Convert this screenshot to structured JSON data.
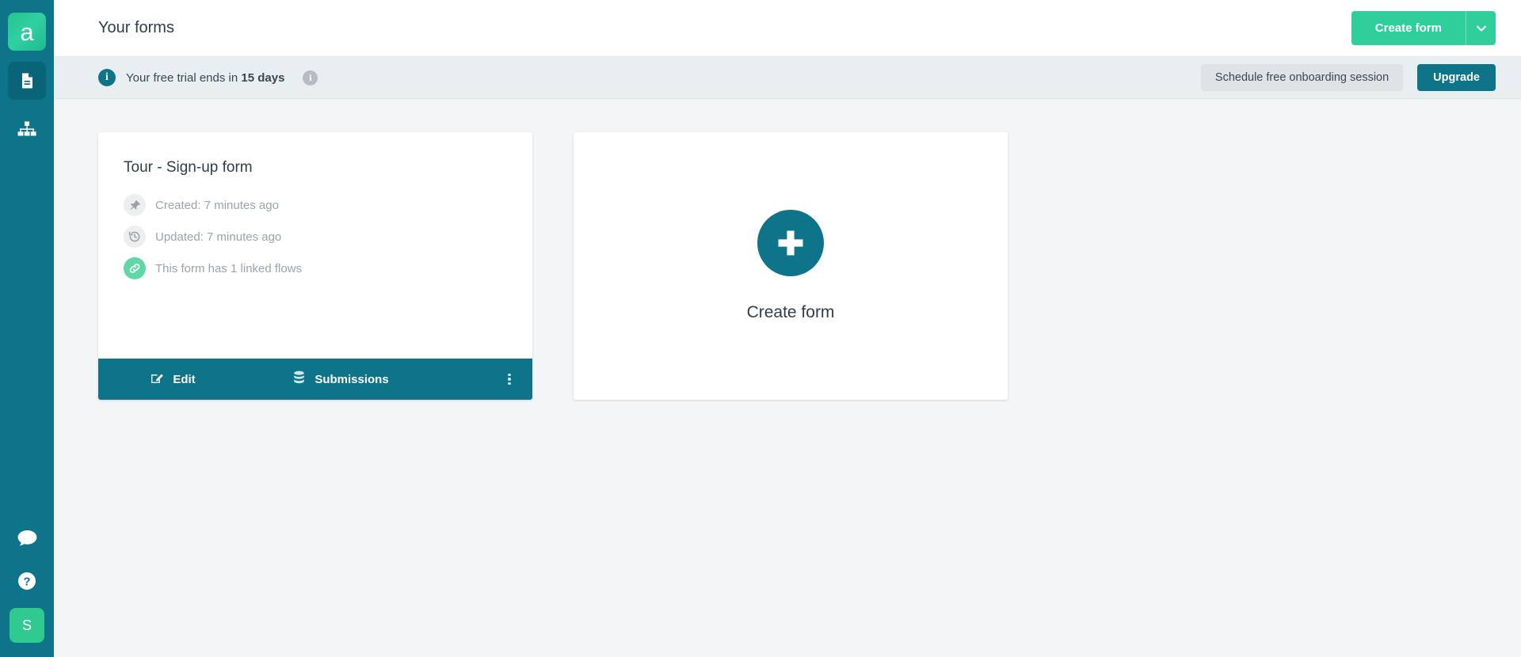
{
  "colors": {
    "sidebar_bg": "#0d7489",
    "brand_green": "#2fce9b",
    "teal": "#0d7489",
    "page_bg": "#f4f5f7",
    "banner_bg": "#e9eef0",
    "muted_text": "#9ba3a9"
  },
  "sidebar": {
    "logo_letter": "a",
    "items": [
      {
        "name": "forms",
        "icon": "document-icon",
        "active": true
      },
      {
        "name": "flows",
        "icon": "sitemap-icon",
        "active": false
      }
    ],
    "bottom": [
      {
        "name": "chat",
        "icon": "chat-bubble-icon"
      },
      {
        "name": "help",
        "icon": "question-circle-icon"
      }
    ],
    "avatar_initial": "S"
  },
  "header": {
    "title": "Your forms",
    "create_label": "Create form",
    "caret_icon": "chevron-down-icon"
  },
  "trial_banner": {
    "info_icon": "info-circle-icon",
    "text_prefix": "Your free trial ends in ",
    "days": "15 days",
    "help_icon": "info-circle-icon",
    "onboarding_label": "Schedule free onboarding session",
    "upgrade_label": "Upgrade"
  },
  "form_card": {
    "title": "Tour - Sign-up form",
    "meta": [
      {
        "icon": "pin-icon",
        "text": "Created: 7 minutes ago"
      },
      {
        "icon": "history-icon",
        "text": "Updated: 7 minutes ago"
      },
      {
        "icon": "link-icon",
        "text": "This form has 1 linked flows"
      }
    ],
    "edit_label": "Edit",
    "submissions_label": "Submissions",
    "kebab_icon": "more-vertical-icon"
  },
  "create_card": {
    "plus_icon": "plus-icon",
    "label": "Create form"
  }
}
